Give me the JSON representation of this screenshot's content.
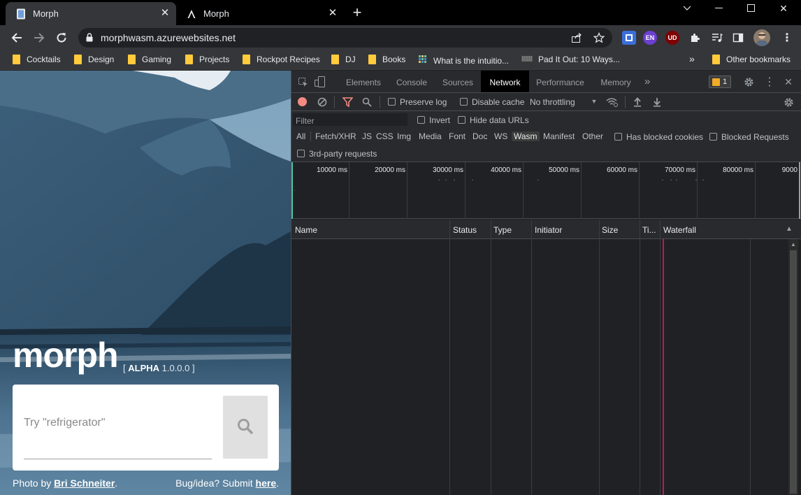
{
  "browser": {
    "tabs": [
      {
        "title": "Morph",
        "active": true
      },
      {
        "title": "Morph",
        "active": false
      }
    ],
    "url": "morphwasm.azurewebsites.net",
    "extensions": {
      "en_label": "EN",
      "ud_label": "UD"
    },
    "bookmarks": [
      {
        "label": "Cocktails",
        "icon": "folder-icon"
      },
      {
        "label": "Design",
        "icon": "folder-icon"
      },
      {
        "label": "Gaming",
        "icon": "folder-icon"
      },
      {
        "label": "Projects",
        "icon": "folder-icon"
      },
      {
        "label": "Rockpot Recipes",
        "icon": "folder-icon"
      },
      {
        "label": "DJ",
        "icon": "folder-icon"
      },
      {
        "label": "Books",
        "icon": "folder-icon"
      },
      {
        "label": "What is the intuitio...",
        "icon": "site-icon"
      },
      {
        "label": "Pad It Out: 10 Ways...",
        "icon": "site-icon"
      }
    ],
    "overflow_label": "»",
    "other_bookmarks": "Other bookmarks"
  },
  "page": {
    "logo": "morph",
    "version_open": "[ ",
    "version_tag": "ALPHA",
    "version_num": " 1.0.0.0 ]",
    "search_placeholder": "Try \"refrigerator\"",
    "photo_prefix": "Photo by ",
    "photo_author": "Bri Schneiter",
    "photo_suffix": ".",
    "bug_prefix": "Bug/idea? Submit ",
    "bug_link": "here",
    "bug_suffix": "."
  },
  "devtools": {
    "tabs": [
      "Elements",
      "Console",
      "Sources",
      "Network",
      "Performance",
      "Memory"
    ],
    "active_tab": "Network",
    "more_tabs": "»",
    "issues_count": "1",
    "toolbar": {
      "preserve_log": "Preserve log",
      "disable_cache": "Disable cache",
      "throttling": "No throttling"
    },
    "filter": {
      "placeholder": "Filter",
      "invert": "Invert",
      "hide_data_urls": "Hide data URLs",
      "types": [
        "All",
        "Fetch/XHR",
        "JS",
        "CSS",
        "Img",
        "Media",
        "Font",
        "Doc",
        "WS",
        "Wasm",
        "Manifest",
        "Other"
      ],
      "selected_type": "Wasm",
      "has_blocked_cookies": "Has blocked cookies",
      "blocked_requests": "Blocked Requests",
      "third_party": "3rd-party requests"
    },
    "overview_ticks": [
      "10000 ms",
      "20000 ms",
      "30000 ms",
      "40000 ms",
      "50000 ms",
      "60000 ms",
      "70000 ms",
      "80000 ms",
      "9000"
    ],
    "columns": [
      "Name",
      "Status",
      "Type",
      "Initiator",
      "Size",
      "Ti...",
      "Waterfall"
    ]
  }
}
